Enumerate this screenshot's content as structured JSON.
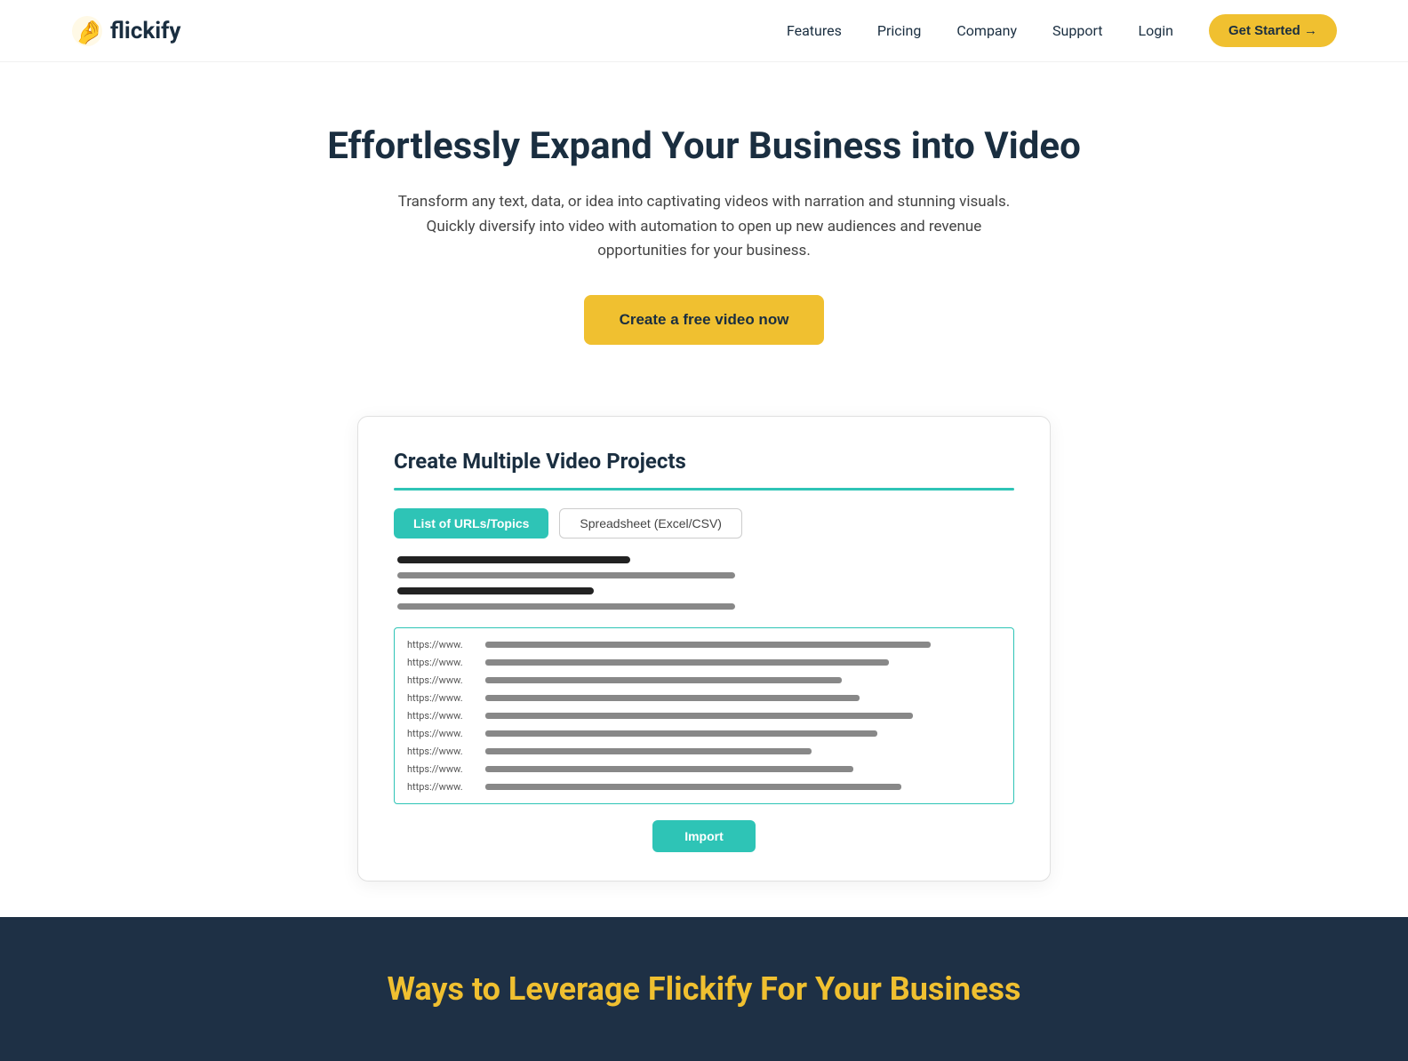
{
  "nav": {
    "logo_text": "flickify",
    "links": [
      {
        "label": "Features",
        "id": "features"
      },
      {
        "label": "Pricing",
        "id": "pricing"
      },
      {
        "label": "Company",
        "id": "company"
      },
      {
        "label": "Support",
        "id": "support"
      },
      {
        "label": "Login",
        "id": "login"
      }
    ],
    "cta_label": "Get Started →"
  },
  "hero": {
    "title": "Effortlessly Expand Your Business into Video",
    "subtitle": "Transform any text, data, or idea into captivating videos with narration and stunning visuals.  Quickly diversify into video with automation to open up new audiences and revenue opportunities for your business.",
    "cta_label": "Create a free video now"
  },
  "demo": {
    "title": "Create Multiple Video Projects",
    "tab_active": "List of URLs/Topics",
    "tab_inactive": "Spreadsheet (Excel/CSV)",
    "urls": [
      {
        "label": "https://www.",
        "width": "75%"
      },
      {
        "label": "https://www.",
        "width": "68%"
      },
      {
        "label": "https://www.",
        "width": "60%"
      },
      {
        "label": "https://www.",
        "width": "63%"
      },
      {
        "label": "https://www.",
        "width": "72%"
      },
      {
        "label": "https://www.",
        "width": "66%"
      },
      {
        "label": "https://www.",
        "width": "55%"
      },
      {
        "label": "https://www.",
        "width": "62%"
      },
      {
        "label": "https://www.",
        "width": "70%"
      }
    ],
    "import_label": "Import",
    "text_lines": [
      {
        "width": "38%"
      },
      {
        "width": "55%"
      },
      {
        "width": "32%"
      },
      {
        "width": "55%"
      }
    ]
  },
  "bottom": {
    "title": "Ways to Leverage Flickify For Your Business"
  },
  "colors": {
    "teal": "#2ec4b6",
    "yellow": "#f0c030",
    "dark_navy": "#1e3045",
    "text_dark": "#1a2e40"
  }
}
